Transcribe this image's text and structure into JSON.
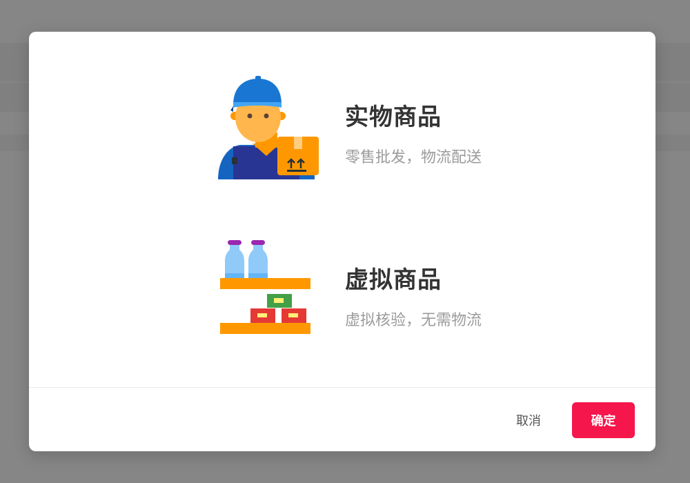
{
  "dialog": {
    "options": [
      {
        "title": "实物商品",
        "description": "零售批发，物流配送",
        "icon": "delivery-worker-icon"
      },
      {
        "title": "虚拟商品",
        "description": "虚拟核验，无需物流",
        "icon": "shelf-products-icon"
      }
    ],
    "footer": {
      "cancel_label": "取消",
      "confirm_label": "确定"
    }
  },
  "colors": {
    "overlay": "rgba(0,0,0,0.45)",
    "confirm_button": "#f5164b",
    "title_text": "#333333",
    "description_text": "#9b9b9b"
  }
}
